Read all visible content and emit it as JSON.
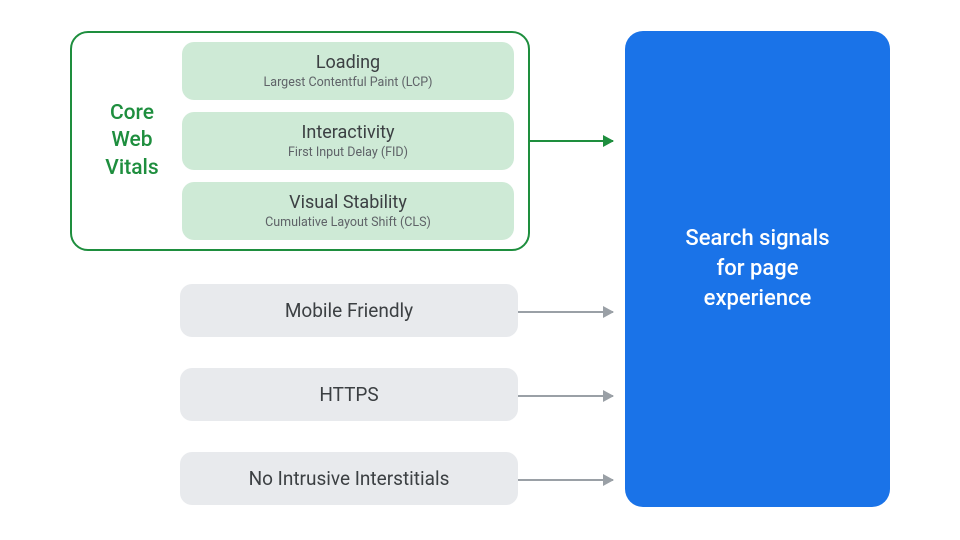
{
  "cwv": {
    "label_line1": "Core",
    "label_line2": "Web",
    "label_line3": "Vitals",
    "items": [
      {
        "title": "Loading",
        "sub": "Largest Contentful Paint (LCP)"
      },
      {
        "title": "Interactivity",
        "sub": "First Input Delay (FID)"
      },
      {
        "title": "Visual Stability",
        "sub": "Cumulative Layout Shift (CLS)"
      }
    ]
  },
  "signals": [
    {
      "label": "Mobile Friendly"
    },
    {
      "label": "HTTPS"
    },
    {
      "label": "No Intrusive Interstitials"
    }
  ],
  "target": {
    "line1": "Search signals",
    "line2": "for page",
    "line3": "experience"
  },
  "colors": {
    "green": "#1e8e3e",
    "green_fill": "#ceead6",
    "gray_fill": "#e8eaed",
    "gray_arrow": "#9aa0a6",
    "blue": "#1a73e8"
  }
}
